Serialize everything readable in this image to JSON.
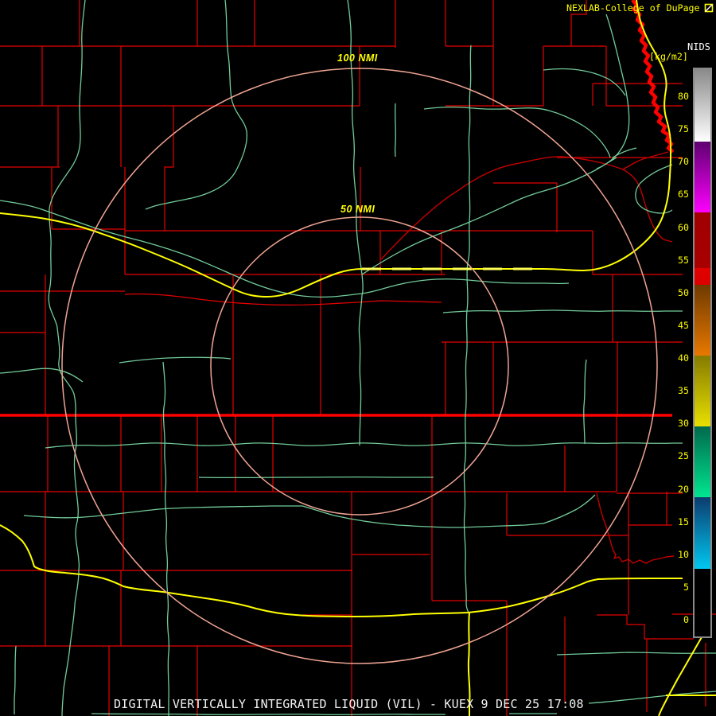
{
  "header": {
    "title": "NEXLAB-College of DuPage",
    "logo_icon": "cod-flag-icon"
  },
  "scale_panel": {
    "system": "NIDS",
    "units": "[kg/m2]",
    "ticks": [
      80,
      75,
      70,
      65,
      60,
      55,
      50,
      45,
      40,
      35,
      30,
      25,
      20,
      15,
      10,
      5,
      0
    ],
    "segments": [
      {
        "min": 73.2,
        "max": 84.2,
        "top": "#8a8a8a",
        "bottom": "#ffffff",
        "name": "gray"
      },
      {
        "min": 62.4,
        "max": 73.2,
        "top": "#5e0070",
        "bottom": "#ff00ff",
        "name": "purple-magenta"
      },
      {
        "min": 53.8,
        "max": 62.4,
        "top": "#a00000",
        "bottom": "#a80000",
        "name": "dark-red"
      },
      {
        "min": 51.3,
        "max": 53.8,
        "top": "#e00000",
        "bottom": "#dd0000",
        "name": "bright-red"
      },
      {
        "min": 40.5,
        "max": 51.3,
        "top": "#6e3a00",
        "bottom": "#e87800",
        "name": "brown-orange"
      },
      {
        "min": 29.7,
        "max": 40.5,
        "top": "#857b00",
        "bottom": "#e8e000",
        "name": "olive-yellow"
      },
      {
        "min": 18.8,
        "max": 29.7,
        "top": "#00694c",
        "bottom": "#00e690",
        "name": "teal-green"
      },
      {
        "min": 7.9,
        "max": 18.8,
        "top": "#0c3c6e",
        "bottom": "#00c8f0",
        "name": "navy-cyan"
      },
      {
        "min": -2.4,
        "max": 7.9,
        "top": "#000000",
        "bottom": "#000000",
        "name": "black"
      }
    ]
  },
  "range_rings": {
    "outer_label": "100 NMI",
    "inner_label": "50 NMI"
  },
  "footer": {
    "product_line": "DIGITAL VERTICALLY INTEGRATED LIQUID (VIL) - KUEX 9 DEC 25 17:08"
  },
  "palette": {
    "background": "#000000",
    "county_line": "#e60000",
    "state_line": "#ff0000",
    "river_red": "#c40000",
    "river_green": "#72cc9a",
    "highway_yellow": "#ffff00",
    "range_ring": "#efa493",
    "label_yellow": "#ffff00",
    "label_white": "#ffffff"
  }
}
